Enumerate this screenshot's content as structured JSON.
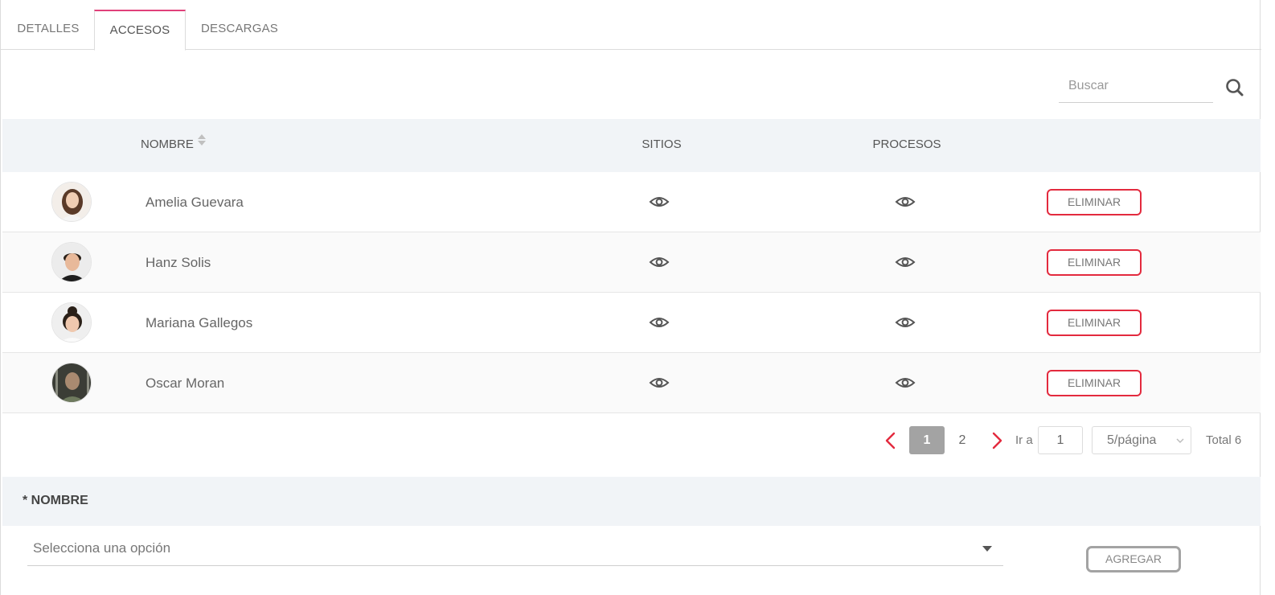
{
  "tabs": [
    {
      "label": "DETALLES",
      "active": false
    },
    {
      "label": "ACCESOS",
      "active": true
    },
    {
      "label": "DESCARGAS",
      "active": false
    }
  ],
  "search": {
    "placeholder": "Buscar",
    "icon": "search-icon"
  },
  "table": {
    "headers": {
      "nombre": "NOMBRE",
      "sitios": "SITIOS",
      "procesos": "PROCESOS"
    },
    "rows": [
      {
        "name": "Amelia Guevara",
        "action": "ELIMINAR"
      },
      {
        "name": "Hanz Solis",
        "action": "ELIMINAR"
      },
      {
        "name": "Mariana Gallegos",
        "action": "ELIMINAR"
      },
      {
        "name": "Oscar Moran",
        "action": "ELIMINAR"
      }
    ]
  },
  "pagination": {
    "pages": [
      "1",
      "2"
    ],
    "current_page": "1",
    "goto_label": "Ir a",
    "goto_value": "1",
    "page_size": "5/página",
    "total": "Total 6"
  },
  "add_form": {
    "label": "* NOMBRE",
    "select_placeholder": "Selecciona una opción",
    "add_button": "AGREGAR"
  },
  "colors": {
    "accent_tab": "#e0407a",
    "danger": "#e32a3e",
    "header_bg": "#f1f4f7",
    "pager_active": "#a3a3a3"
  }
}
